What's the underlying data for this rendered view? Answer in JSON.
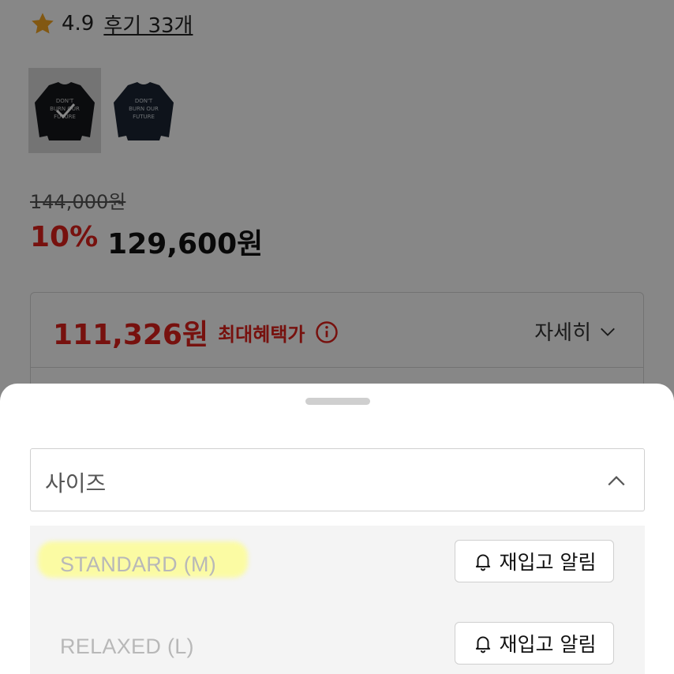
{
  "product": {
    "rating": "4.9",
    "reviews_link": "후기 33개",
    "original_price": "144,000원",
    "discount": "10%",
    "sale_price": "129,600원",
    "benefit": {
      "price": "111,326원",
      "label": "최대혜택가",
      "detail_link": "자세히"
    },
    "thumbnails": [
      {
        "name": "black-sweatshirt",
        "print": "DON'T BURN OUR FUTURE",
        "color": "#15171c",
        "selected": true
      },
      {
        "name": "navy-sweatshirt",
        "print": "DON'T BURN OUR FUTURE",
        "color": "#1c2533",
        "selected": false
      }
    ]
  },
  "sheet": {
    "select_label": "사이즈",
    "options": [
      {
        "label": "STANDARD (M)",
        "button": "재입고 알림",
        "highlighted": true
      },
      {
        "label": "RELAXED (L)",
        "button": "재입고 알림",
        "highlighted": false
      }
    ]
  },
  "colors": {
    "accent_red": "#e0201b",
    "star": "#f5a623",
    "highlight": "#fbfba3",
    "overlay": "rgba(0,0,0,0.47)"
  },
  "icons": [
    "star-icon",
    "info-icon",
    "chevron-down-icon",
    "chevron-up-icon",
    "bell-icon",
    "check-icon"
  ]
}
